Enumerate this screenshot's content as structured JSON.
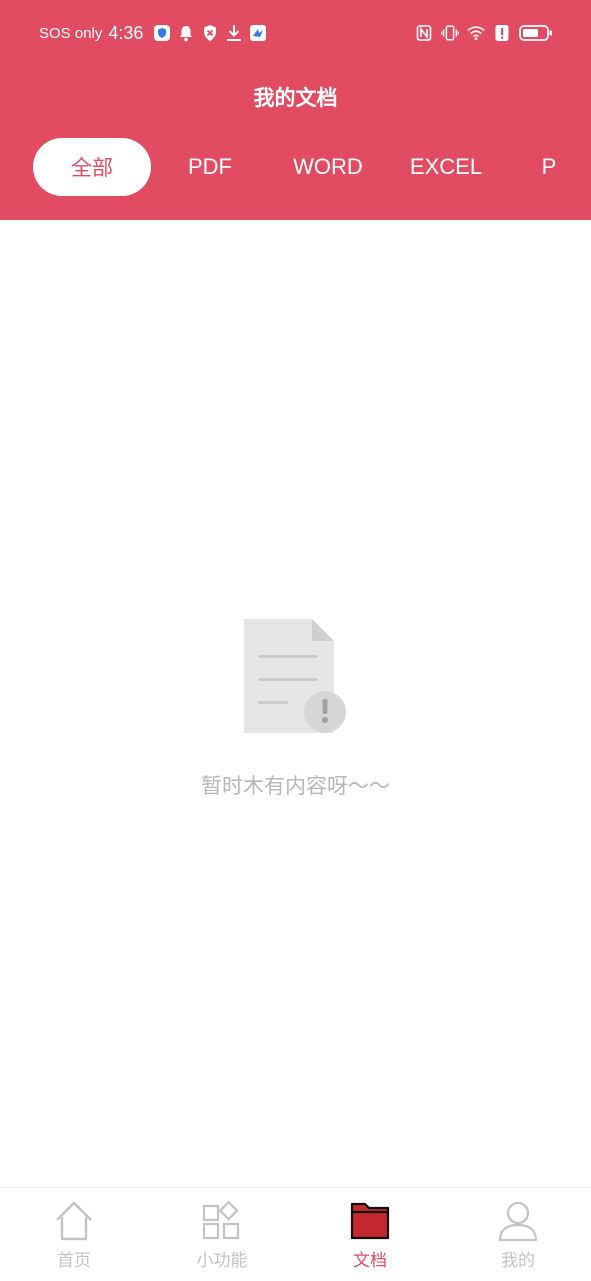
{
  "status_bar": {
    "carrier": "SOS only",
    "time": "4:36"
  },
  "header": {
    "title": "我的文档"
  },
  "tabs": [
    {
      "label": "全部",
      "active": true
    },
    {
      "label": "PDF",
      "active": false
    },
    {
      "label": "WORD",
      "active": false
    },
    {
      "label": "EXCEL",
      "active": false
    },
    {
      "label": "P",
      "active": false
    }
  ],
  "empty_state": {
    "icon": "document-warning-icon",
    "message": "暂时木有内容呀～～"
  },
  "bottom_nav": [
    {
      "label": "首页",
      "icon": "home-icon",
      "active": false
    },
    {
      "label": "小功能",
      "icon": "apps-icon",
      "active": false
    },
    {
      "label": "文档",
      "icon": "folder-icon",
      "active": true
    },
    {
      "label": "我的",
      "icon": "user-icon",
      "active": false
    }
  ],
  "colors": {
    "primary": "#e24c62",
    "inactive": "#c4c4c4",
    "empty_text": "#b8b8b8"
  }
}
